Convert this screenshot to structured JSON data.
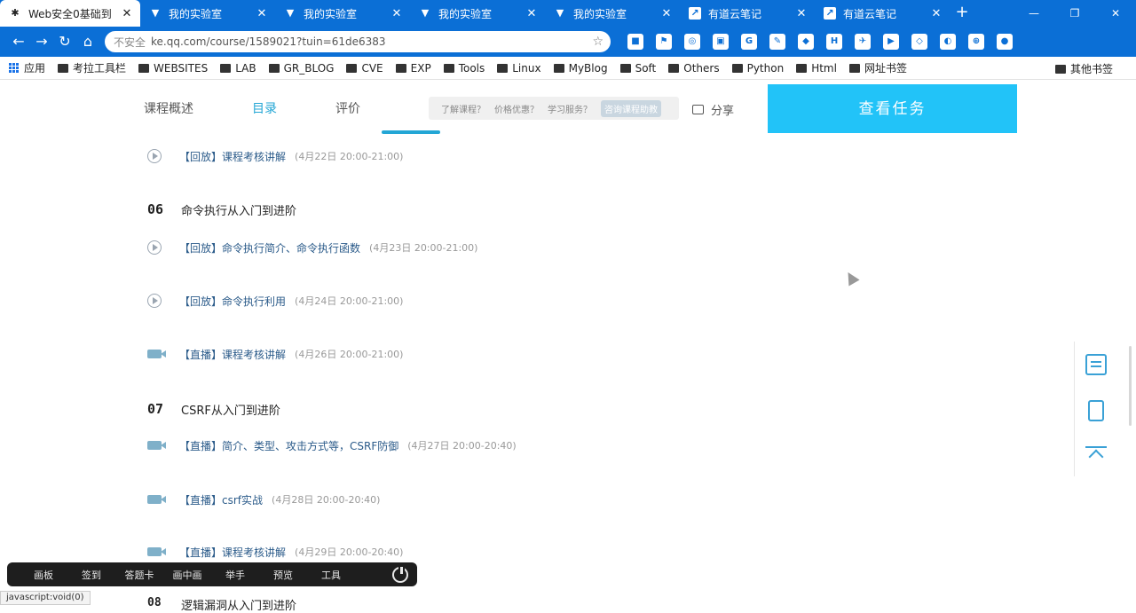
{
  "browser": {
    "tabs": [
      {
        "title": "Web安全0基础到",
        "icon": "gear-icon",
        "active": true
      },
      {
        "title": "我的实验室",
        "icon": "shield-icon"
      },
      {
        "title": "我的实验室",
        "icon": "shield-icon"
      },
      {
        "title": "我的实验室",
        "icon": "shield-icon"
      },
      {
        "title": "我的实验室",
        "icon": "shield-icon"
      },
      {
        "title": "有道云笔记",
        "icon": "note-icon"
      },
      {
        "title": "有道云笔记",
        "icon": "note-icon"
      }
    ],
    "url": "ke.qq.com/course/1589021?tuin=61de6383",
    "security_label": "不安全",
    "bookmarks": [
      {
        "label": "应用",
        "icon": "apps-icon"
      },
      {
        "label": "考拉工具栏",
        "icon": "folder-icon"
      },
      {
        "label": "WEBSITES",
        "icon": "folder-icon"
      },
      {
        "label": "LAB",
        "icon": "folder-icon"
      },
      {
        "label": "GR_BLOG",
        "icon": "folder-icon"
      },
      {
        "label": "CVE",
        "icon": "folder-icon"
      },
      {
        "label": "EXP",
        "icon": "folder-icon"
      },
      {
        "label": "Tools",
        "icon": "folder-icon"
      },
      {
        "label": "Linux",
        "icon": "folder-icon"
      },
      {
        "label": "MyBlog",
        "icon": "folder-icon"
      },
      {
        "label": "Soft",
        "icon": "folder-icon"
      },
      {
        "label": "Others",
        "icon": "folder-icon"
      },
      {
        "label": "Python",
        "icon": "folder-icon"
      },
      {
        "label": "Html",
        "icon": "folder-icon"
      },
      {
        "label": "网址书签",
        "icon": "folder-icon"
      }
    ],
    "bookmarks_more": "»",
    "bookmarks_other": "其他书签"
  },
  "course_nav": {
    "tabs": [
      "课程概述",
      "目录",
      "评价"
    ],
    "active_tab": 1,
    "consult": [
      "了解课程？",
      "价格优惠？",
      "学习服务？",
      "咨询课程助教"
    ],
    "share_label": "分享",
    "task_button": "查看任务"
  },
  "lessons": [
    {
      "tag": "【回放】",
      "name": "课程考核讲解",
      "time": "(4月22日 20:00-21:00)",
      "kind": "replay"
    },
    {
      "tag": "【回放】",
      "name": "命令执行简介、命令执行函数",
      "time": "(4月23日 20:00-21:00)",
      "kind": "replay"
    },
    {
      "tag": "【回放】",
      "name": "命令执行利用",
      "time": "(4月24日 20:00-21:00)",
      "kind": "replay"
    },
    {
      "tag": "【直播】",
      "name": "课程考核讲解",
      "time": "(4月26日 20:00-21:00)",
      "kind": "live"
    },
    {
      "tag": "【直播】",
      "name": "简介、类型、攻击方式等，CSRF防御",
      "time": "(4月27日 20:00-20:40)",
      "kind": "live"
    },
    {
      "tag": "【直播】",
      "name": "csrf实战",
      "time": "(4月28日 20:00-20:40)",
      "kind": "live"
    },
    {
      "tag": "【直播】",
      "name": "课程考核讲解",
      "time": "(4月29日 20:00-20:40)",
      "kind": "live"
    }
  ],
  "chapters": [
    {
      "num": "06",
      "title": "命令执行从入门到进阶"
    },
    {
      "num": "07",
      "title": "CSRF从入门到进阶"
    },
    {
      "num": "08",
      "title": "逻辑漏洞从入门到进阶"
    }
  ],
  "overlay_toolbar": [
    "画板",
    "签到",
    "答题卡",
    "画中画",
    "举手",
    "预览",
    "工具"
  ],
  "status_text": "javascript:void(0)",
  "colors": {
    "chrome_blue": "#0b6fd6",
    "accent": "#23a6d5",
    "task_button": "#22c3f8"
  }
}
